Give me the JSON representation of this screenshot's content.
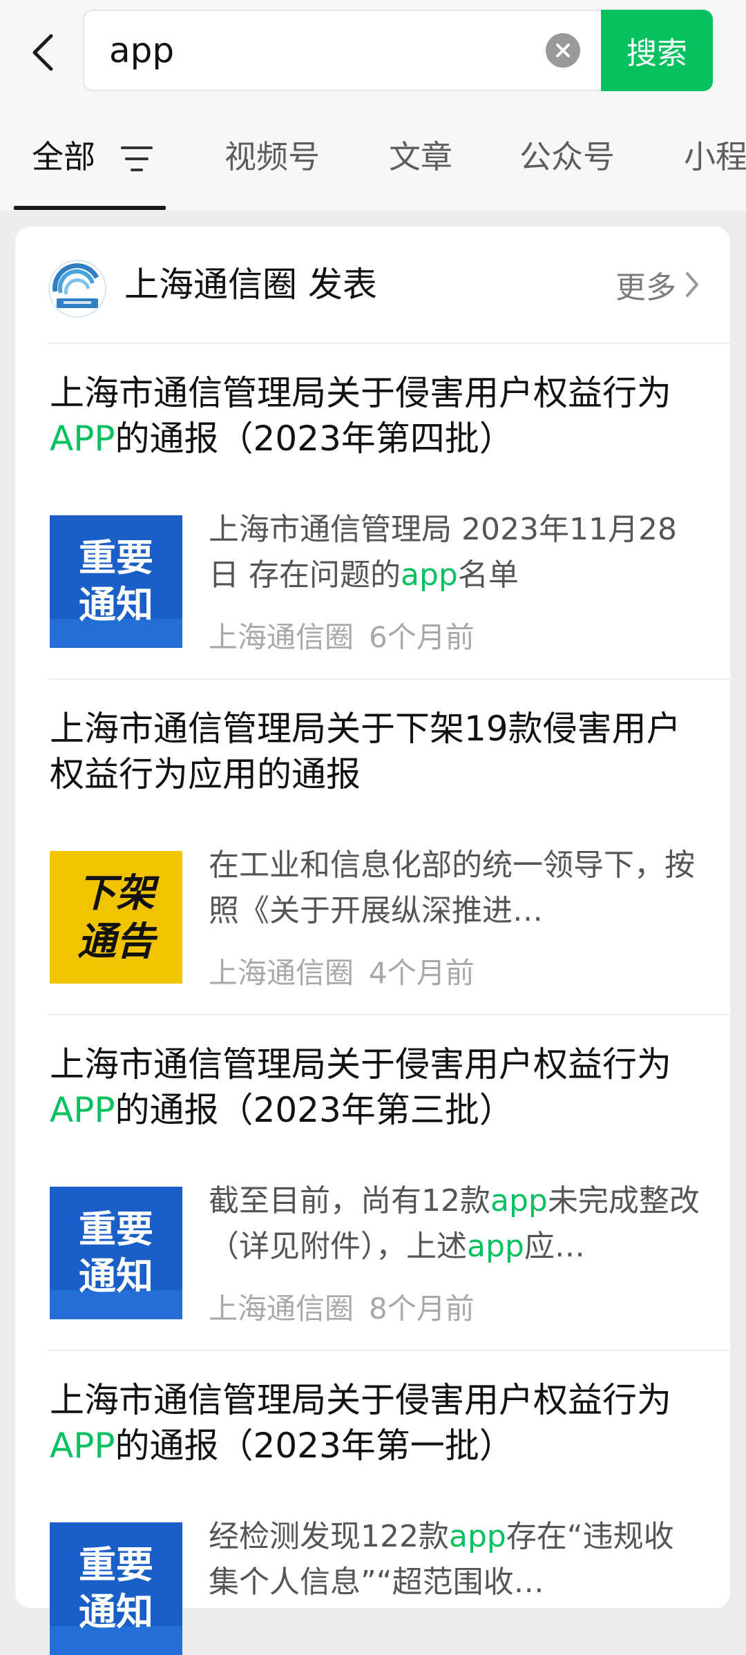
{
  "search": {
    "query": "app",
    "submit_label": "搜索"
  },
  "tabs": [
    {
      "label": "全部",
      "active": true
    },
    {
      "label": "视频号"
    },
    {
      "label": "文章"
    },
    {
      "label": "公众号"
    },
    {
      "label": "小程"
    }
  ],
  "source": {
    "name": "上海通信圈 发表",
    "more_label": "更多"
  },
  "results": [
    {
      "title_parts": [
        "上海市通信管理局关于侵害用户权益行为",
        "APP",
        "的通报（2023年第四批）"
      ],
      "thumb_text": [
        "重要",
        "通知"
      ],
      "desc_parts": [
        "上海市通信管理局 2023年11月28日 存在问题的",
        "app",
        "名单"
      ],
      "author": "上海通信圈",
      "time": "6个月前"
    },
    {
      "title_parts": [
        "上海市通信管理局关于下架19款侵害用户权益行为应用的通报",
        "",
        ""
      ],
      "thumb_text": [
        "下架",
        "通告"
      ],
      "desc_parts": [
        "在工业和信息化部的统一领导下，按照《关于开展纵深推进…",
        "",
        ""
      ],
      "author": "上海通信圈",
      "time": "4个月前"
    },
    {
      "title_parts": [
        "上海市通信管理局关于侵害用户权益行为",
        "APP",
        "的通报（2023年第三批）"
      ],
      "thumb_text": [
        "重要",
        "通知"
      ],
      "desc_parts": [
        "截至目前，尚有12款",
        "app",
        "未完成整改（详见附件），上述",
        "app",
        "应…"
      ],
      "author": "上海通信圈",
      "time": "8个月前"
    },
    {
      "title_parts": [
        "上海市通信管理局关于侵害用户权益行为",
        "APP",
        "的通报（2023年第一批）"
      ],
      "thumb_text": [
        "重要",
        "通知"
      ],
      "desc_parts": [
        "经检测发现122款",
        "app",
        "存在“违规收集个人信息”“超范围收…"
      ]
    }
  ],
  "colors": {
    "accent": "#07c160",
    "notice_blue": "#1a5fc8",
    "notice_yellow": "#f2c300"
  },
  "icons": [
    "back-icon",
    "clear-icon",
    "filter-icon",
    "chevron-right-icon",
    "source-logo"
  ]
}
